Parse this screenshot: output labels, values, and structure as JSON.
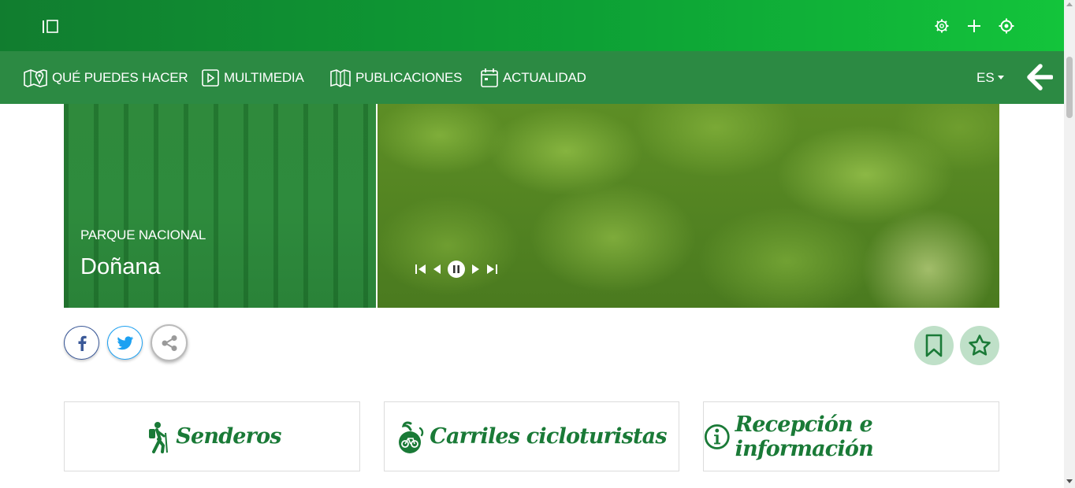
{
  "topbar": {
    "icons": [
      "sidebar-toggle-icon",
      "gear-icon",
      "plus-icon",
      "crosshair-icon"
    ]
  },
  "nav": {
    "items": [
      {
        "label": "QUÉ PUEDES HACER",
        "icon": "map-pin-icon"
      },
      {
        "label": "MULTIMEDIA",
        "icon": "play-icon"
      },
      {
        "label": "PUBLICACIONES",
        "icon": "book-icon"
      },
      {
        "label": "ACTUALIDAD",
        "icon": "calendar-icon"
      }
    ],
    "language": "ES",
    "back_icon": "arrow-left-icon"
  },
  "hero": {
    "subtitle": "PARQUE NACIONAL",
    "title": "Doñana",
    "controls": [
      "first-icon",
      "prev-icon",
      "pause-icon",
      "next-icon",
      "last-icon"
    ]
  },
  "share": {
    "buttons": [
      "facebook-icon",
      "twitter-icon",
      "share-icon"
    ]
  },
  "actions": [
    "bookmark-icon",
    "star-icon"
  ],
  "cards": [
    {
      "label": "Senderos",
      "icon": "hiker-icon"
    },
    {
      "label": "Carriles cicloturistas",
      "icon": "bike-icon"
    },
    {
      "label": "Recepción e información",
      "icon": "info-icon"
    }
  ],
  "colors": {
    "brand_green": "#2c8a43",
    "topbar_green": "#0da035",
    "card_text": "#1a7a37",
    "action_bg": "#bfe0c8"
  }
}
